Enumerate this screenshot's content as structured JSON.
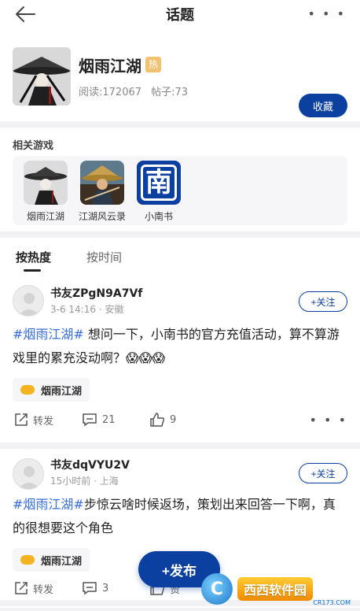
{
  "topbar": {
    "title": "话题"
  },
  "topic": {
    "title": "烟雨江湖",
    "hot_badge": "热",
    "reads": "阅读:172067",
    "posts": "帖子:73",
    "collect_label": "收藏"
  },
  "related": {
    "title": "相关游戏",
    "games": [
      {
        "name": "烟雨江湖",
        "icon": "ink-swordsman-icon"
      },
      {
        "name": "江湖风云录",
        "icon": "straw-hat-hero-icon"
      },
      {
        "name": "小南书",
        "icon": "nan-character-icon",
        "glyph": "南"
      }
    ]
  },
  "tabs": [
    {
      "label": "按热度"
    },
    {
      "label": "按时间"
    }
  ],
  "posts": [
    {
      "user": "书友ZPgN9A7Vf",
      "meta": "3-6  14:16 · 安徽",
      "follow_label": "+关注",
      "tag": "#烟雨江湖#",
      "text": " 想问一下，小南书的官方充值活动，算不算游戏里的累充没动啊？",
      "emoji": "😱😱😱",
      "game_tag": "烟雨江湖",
      "share_label": "转发",
      "comments": "21",
      "likes": "9"
    },
    {
      "user": "书友dqVYU2V",
      "meta": "15小时前 · 上海",
      "follow_label": "+关注",
      "tag": "#烟雨江湖#",
      "text": "步惊云啥时候返场，策划出来回答一下啊，真的很想要这个角色",
      "game_tag": "烟雨江湖",
      "share_label": "转发",
      "comments": "3",
      "likes": "赞"
    }
  ],
  "publish_label": "+发布",
  "watermark": {
    "logo": "C",
    "text": "西西软件园",
    "sub": "CR173.COM"
  },
  "colors": {
    "brand": "#0b3fa0",
    "tag": "#3a6fd8",
    "hot": "#f2c270"
  }
}
